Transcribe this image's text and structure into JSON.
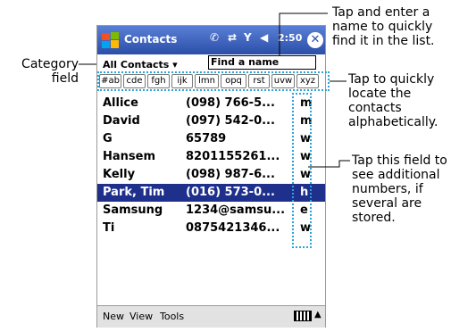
{
  "app": {
    "title": "Contacts",
    "time": "2:50",
    "close_label": "✕"
  },
  "category": {
    "label": "All Contacts ▾"
  },
  "search": {
    "value": "Find a name"
  },
  "letter_buttons": [
    "#ab",
    "cde",
    "fgh",
    "ijk",
    "lmn",
    "opq",
    "rst",
    "uvw",
    "xyz"
  ],
  "contacts": [
    {
      "name": "Allice",
      "phone": "(098) 766-5...",
      "type": "m",
      "selected": false
    },
    {
      "name": "David",
      "phone": "(097) 542-0...",
      "type": "m",
      "selected": false
    },
    {
      "name": "G",
      "phone": "65789",
      "type": "w",
      "selected": false
    },
    {
      "name": "Hansem",
      "phone": "8201155261...",
      "type": "w",
      "selected": false
    },
    {
      "name": "Kelly",
      "phone": "(098) 987-6...",
      "type": "w",
      "selected": false
    },
    {
      "name": "Park, Tim",
      "phone": "(016) 573-0...",
      "type": "h",
      "selected": true
    },
    {
      "name": "Samsung",
      "phone": "1234@samsu...",
      "type": "e",
      "selected": false
    },
    {
      "name": "Ti",
      "phone": "0875421346...",
      "type": "w",
      "selected": false
    }
  ],
  "menu": {
    "new": "New",
    "view": "View",
    "tools": "Tools"
  },
  "annotations": {
    "category_field": "Category\nfield",
    "find_name": "Tap and enter a\nname to quickly\nfind it in the list.",
    "alpha": "Tap to quickly\nlocate the\ncontacts\nalphabetically.",
    "additional": "Tap this field to\nsee additional\nnumbers, if\nseveral are\nstored."
  },
  "colors": {
    "accent": "#2ea3d6",
    "titlebar": "#2b4fa8",
    "selection": "#1e2f8c"
  }
}
